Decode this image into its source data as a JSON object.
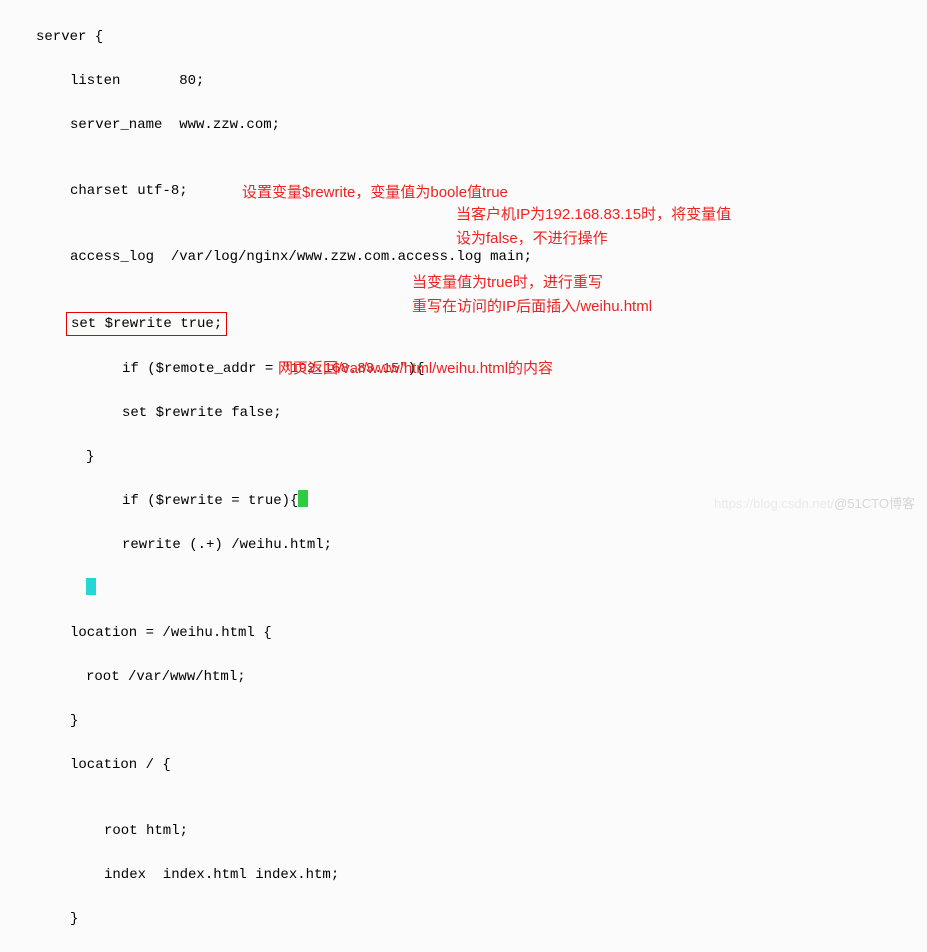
{
  "code": {
    "l1": "server {",
    "l2": "listen       80;",
    "l3": "server_name  www.zzw.com;",
    "l4": "",
    "l5": "charset utf-8;",
    "l6": "",
    "l7": "access_log  /var/log/nginx/www.zzw.com.access.log main;",
    "l8": "",
    "l9": "set $rewrite true;",
    "l10a": "if ($remote_addr = ",
    "l10b": "\"192.168.83.15\"",
    "l10c": "){",
    "l11": "set $rewrite false;",
    "l12": "}",
    "l13": "if ($rewrite = true){",
    "l14": "rewrite (.+) /weihu.html;",
    "l15": "",
    "l16": "location = /weihu.html {",
    "l17": "root /var/www/html;",
    "l18": "}",
    "l19": "location / {",
    "l20": "",
    "l21": "root html;",
    "l22": "index  index.html index.htm;",
    "l23": "}"
  },
  "notes": {
    "n1": "设置变量$rewrite，变量值为boole值true",
    "n2a": "当客户机IP为192.168.83.15时，将变量值",
    "n2b": "设为false，不进行操作",
    "n3a": "当变量值为true时，进行重写",
    "n3b": "重写在访问的IP后面插入/weihu.html",
    "n4": "网页返回/var/www/html/weihu.html的内容"
  },
  "watermark": {
    "left": "https://blog.csdn.net/",
    "right": "@51CTO博客"
  }
}
